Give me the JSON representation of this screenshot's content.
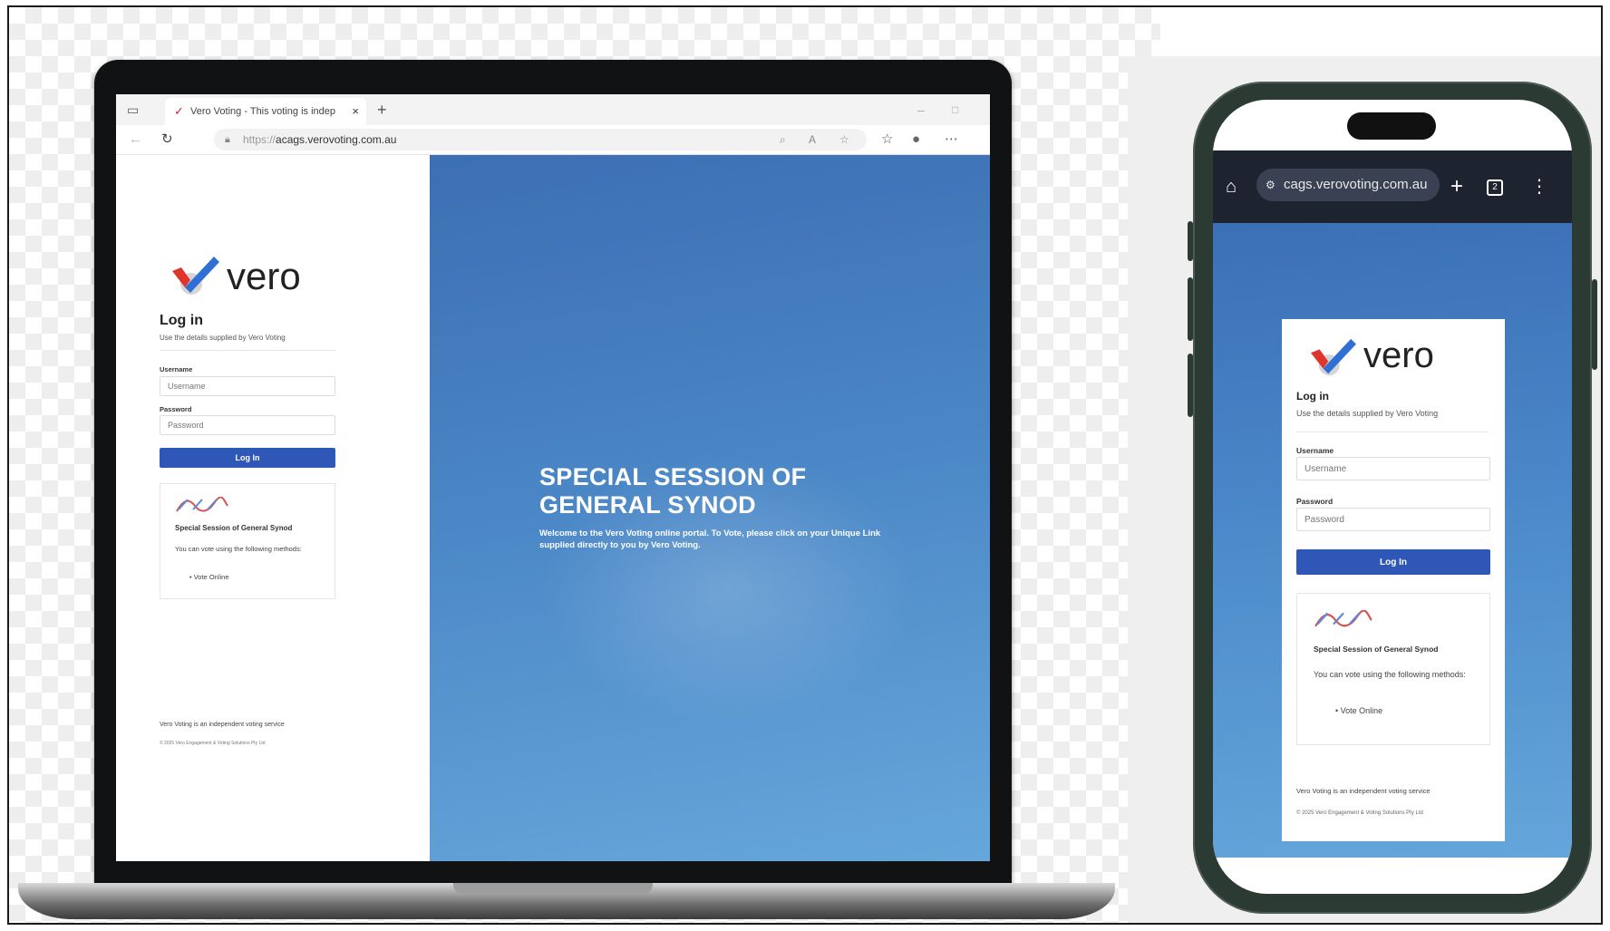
{
  "desktop": {
    "browser": {
      "tab_title": "Vero Voting - This voting is indep",
      "tab_close": "×",
      "new_tab": "+",
      "url_proto": "https://",
      "url_host": "acags.verovoting.com.au"
    },
    "login": {
      "logo_word": "vero",
      "heading": "Log in",
      "instructions": "Use the details supplied by Vero Voting",
      "username_label": "Username",
      "username_placeholder": "Username",
      "password_label": "Password",
      "password_placeholder": "Password",
      "submit_label": "Log In",
      "card": {
        "title": "Special Session of General Synod",
        "text": "You can vote using the following methods:",
        "bullet": "Vote Online"
      },
      "footer_line1": "Vero Voting is an independent voting service",
      "footer_line2": "© 2025 Vero Engagement & Voting Solutions Pty Ltd"
    },
    "hero": {
      "title_line1": "SPECIAL SESSION OF",
      "title_line2": "GENERAL SYNOD",
      "subtitle": "Welcome to the Vero Voting online portal. To Vote, please click on your Unique Link supplied directly to you by Vero Voting."
    }
  },
  "mobile": {
    "browser": {
      "url_host": "cags.verovoting.com.au",
      "tab_count": "2"
    },
    "login": {
      "logo_word": "vero",
      "heading": "Log in",
      "instructions": "Use the details supplied by Vero Voting",
      "username_label": "Username",
      "username_placeholder": "Username",
      "password_label": "Password",
      "password_placeholder": "Password",
      "submit_label": "Log In",
      "card": {
        "title": "Special Session of General Synod",
        "text": "You can vote using the following methods:",
        "bullet": "Vote Online"
      },
      "footer_line1": "Vero Voting is an independent voting service",
      "footer_line2": "© 2025 Vero Engagement & Voting Solutions Pty Ltd"
    }
  },
  "colors": {
    "brand_blue": "#2f57b8",
    "hero_blue": "#4a86c6",
    "logo_red": "#e0352b",
    "logo_blue": "#2f6fd6"
  },
  "icons": {
    "desktop_toolbar": [
      "sidebar-icon",
      "back-icon",
      "refresh-icon",
      "lock-icon",
      "zoom-icon",
      "read-aloud-icon",
      "favorite-icon",
      "collections-icon",
      "profile-icon",
      "more-icon"
    ],
    "mobile_toolbar": [
      "home-icon",
      "site-settings-icon",
      "new-tab-icon",
      "tab-switcher-icon",
      "menu-icon"
    ]
  }
}
